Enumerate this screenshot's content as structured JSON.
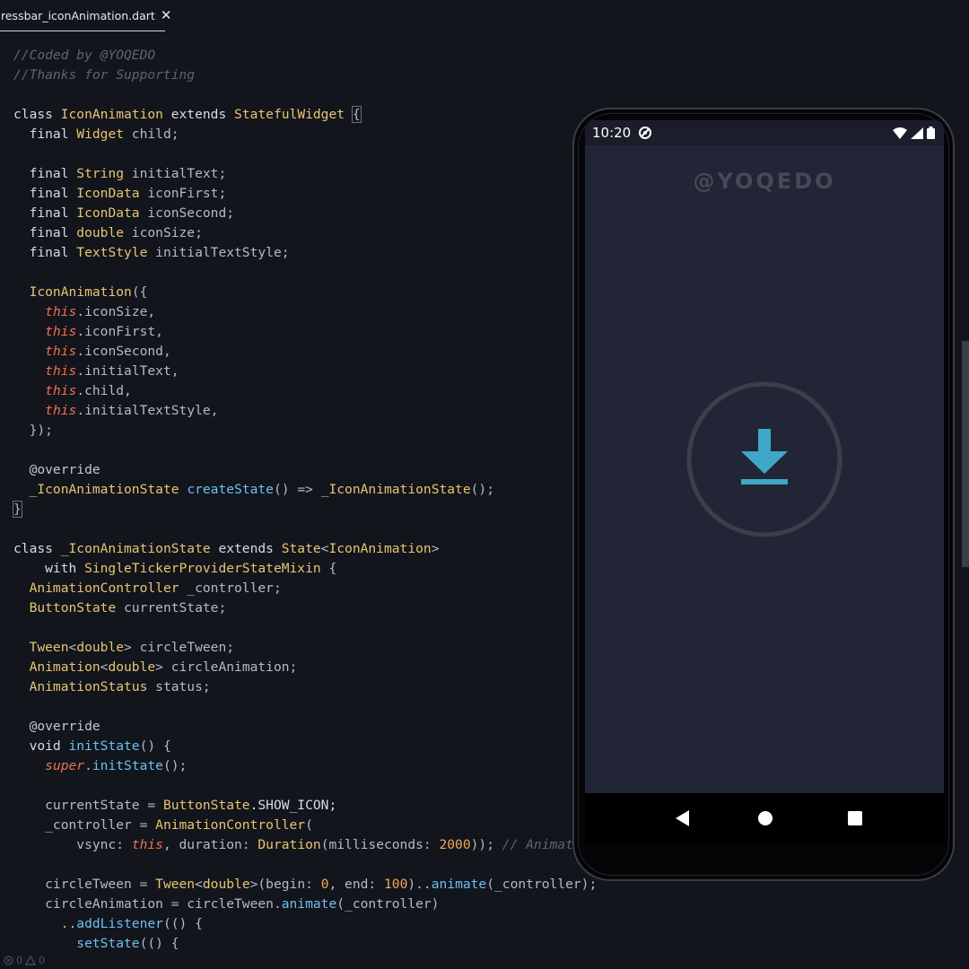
{
  "editor": {
    "tab": {
      "title": "ressbar_iconAnimation.dart",
      "close_glyph": "✕"
    },
    "code_lines": [
      [
        [
          "//Coded by @YOQEDO",
          "cm"
        ]
      ],
      [
        [
          "//Thanks for Supporting",
          "cm"
        ]
      ],
      [],
      [
        [
          "class ",
          "kw"
        ],
        [
          "IconAnimation",
          "ty"
        ],
        [
          " extends ",
          "kw"
        ],
        [
          "StatefulWidget",
          "ty"
        ],
        [
          " ",
          ""
        ],
        [
          "{",
          "br"
        ]
      ],
      [
        [
          "  final ",
          "kw"
        ],
        [
          "Widget",
          "ty"
        ],
        [
          " child;",
          ""
        ]
      ],
      [],
      [
        [
          "  final ",
          "kw"
        ],
        [
          "String",
          "ty"
        ],
        [
          " initialText;",
          ""
        ]
      ],
      [
        [
          "  final ",
          "kw"
        ],
        [
          "IconData",
          "ty"
        ],
        [
          " iconFirst;",
          ""
        ]
      ],
      [
        [
          "  final ",
          "kw"
        ],
        [
          "IconData",
          "ty"
        ],
        [
          " iconSecond;",
          ""
        ]
      ],
      [
        [
          "  final ",
          "kw"
        ],
        [
          "double",
          "ty"
        ],
        [
          " iconSize;",
          ""
        ]
      ],
      [
        [
          "  final ",
          "kw"
        ],
        [
          "TextStyle",
          "ty"
        ],
        [
          " initialTextStyle;",
          ""
        ]
      ],
      [],
      [
        [
          "  ",
          ""
        ],
        [
          "IconAnimation",
          "ty"
        ],
        [
          "({",
          ""
        ]
      ],
      [
        [
          "    ",
          ""
        ],
        [
          "this",
          "this"
        ],
        [
          ".iconSize,",
          ""
        ]
      ],
      [
        [
          "    ",
          ""
        ],
        [
          "this",
          "this"
        ],
        [
          ".iconFirst,",
          ""
        ]
      ],
      [
        [
          "    ",
          ""
        ],
        [
          "this",
          "this"
        ],
        [
          ".iconSecond,",
          ""
        ]
      ],
      [
        [
          "    ",
          ""
        ],
        [
          "this",
          "this"
        ],
        [
          ".initialText,",
          ""
        ]
      ],
      [
        [
          "    ",
          ""
        ],
        [
          "this",
          "this"
        ],
        [
          ".child,",
          ""
        ]
      ],
      [
        [
          "    ",
          ""
        ],
        [
          "this",
          "this"
        ],
        [
          ".initialTextStyle,",
          ""
        ]
      ],
      [
        [
          "  });",
          ""
        ]
      ],
      [],
      [
        [
          "  @override",
          "an"
        ]
      ],
      [
        [
          "  ",
          ""
        ],
        [
          "_IconAnimationState",
          "ty"
        ],
        [
          " ",
          ""
        ],
        [
          "createState",
          "fn"
        ],
        [
          "() => ",
          ""
        ],
        [
          "_IconAnimationState",
          "ty"
        ],
        [
          "();",
          ""
        ]
      ],
      [
        [
          "}",
          "br"
        ]
      ],
      [],
      [
        [
          "class ",
          "kw"
        ],
        [
          "_IconAnimationState",
          "ty"
        ],
        [
          " extends ",
          "kw"
        ],
        [
          "State",
          "ty"
        ],
        [
          "<",
          ""
        ],
        [
          "IconAnimation",
          "ty"
        ],
        [
          ">",
          ""
        ]
      ],
      [
        [
          "    with ",
          "kw"
        ],
        [
          "SingleTickerProviderStateMixin",
          "ty"
        ],
        [
          " {",
          ""
        ]
      ],
      [
        [
          "  ",
          ""
        ],
        [
          "AnimationController",
          "ty"
        ],
        [
          " _controller;",
          ""
        ]
      ],
      [
        [
          "  ",
          ""
        ],
        [
          "ButtonState",
          "ty"
        ],
        [
          " currentState;",
          ""
        ]
      ],
      [],
      [
        [
          "  ",
          ""
        ],
        [
          "Tween",
          "ty"
        ],
        [
          "<",
          ""
        ],
        [
          "double",
          "ty"
        ],
        [
          "> circleTween;",
          ""
        ]
      ],
      [
        [
          "  ",
          ""
        ],
        [
          "Animation",
          "ty"
        ],
        [
          "<",
          ""
        ],
        [
          "double",
          "ty"
        ],
        [
          "> circleAnimation;",
          ""
        ]
      ],
      [
        [
          "  ",
          ""
        ],
        [
          "AnimationStatus",
          "ty"
        ],
        [
          " status;",
          ""
        ]
      ],
      [],
      [
        [
          "  @override",
          "an"
        ]
      ],
      [
        [
          "  void ",
          "kw"
        ],
        [
          "initState",
          "fn"
        ],
        [
          "() {",
          ""
        ]
      ],
      [
        [
          "    ",
          ""
        ],
        [
          "super",
          "this"
        ],
        [
          ".",
          ""
        ],
        [
          "initState",
          "fn"
        ],
        [
          "();",
          ""
        ]
      ],
      [],
      [
        [
          "    currentState = ",
          ""
        ],
        [
          "ButtonState",
          "ty"
        ],
        [
          ".SHOW_ICON;",
          "kw"
        ]
      ],
      [
        [
          "    _controller = ",
          ""
        ],
        [
          "AnimationController",
          "ty"
        ],
        [
          "(",
          ""
        ]
      ],
      [
        [
          "        vsync: ",
          ""
        ],
        [
          "this",
          "this"
        ],
        [
          ", duration: ",
          ""
        ],
        [
          "Duration",
          "ty"
        ],
        [
          "(milliseconds: ",
          ""
        ],
        [
          "2000",
          "num"
        ],
        [
          "));",
          ""
        ],
        [
          " // Animat",
          "cm"
        ]
      ],
      [],
      [
        [
          "    circleTween = ",
          ""
        ],
        [
          "Tween",
          "ty"
        ],
        [
          "<",
          ""
        ],
        [
          "double",
          "ty"
        ],
        [
          ">(begin: ",
          ""
        ],
        [
          "0",
          "num"
        ],
        [
          ", end: ",
          ""
        ],
        [
          "100",
          "num"
        ],
        [
          ")..",
          ""
        ],
        [
          "animate",
          "fn"
        ],
        [
          "(_controller);",
          ""
        ]
      ],
      [
        [
          "    circleAnimation = circleTween.",
          ""
        ],
        [
          "animate",
          "fn"
        ],
        [
          "(_controller)",
          ""
        ]
      ],
      [
        [
          "      ..",
          ""
        ],
        [
          "addListener",
          "fn"
        ],
        [
          "(() {",
          ""
        ]
      ],
      [
        [
          "        ",
          ""
        ],
        [
          "setState",
          "fn"
        ],
        [
          "(() {",
          ""
        ]
      ]
    ],
    "bottom_status": {
      "errors": "0",
      "warnings": "0"
    }
  },
  "phone": {
    "status_bar": {
      "time": "10:20"
    },
    "app_title": "@YOQEDO",
    "download_icon": "download-icon",
    "colors": {
      "screen_bg": "#222535",
      "ring": "#3b3e4b",
      "accent": "#3fa8c8"
    }
  }
}
